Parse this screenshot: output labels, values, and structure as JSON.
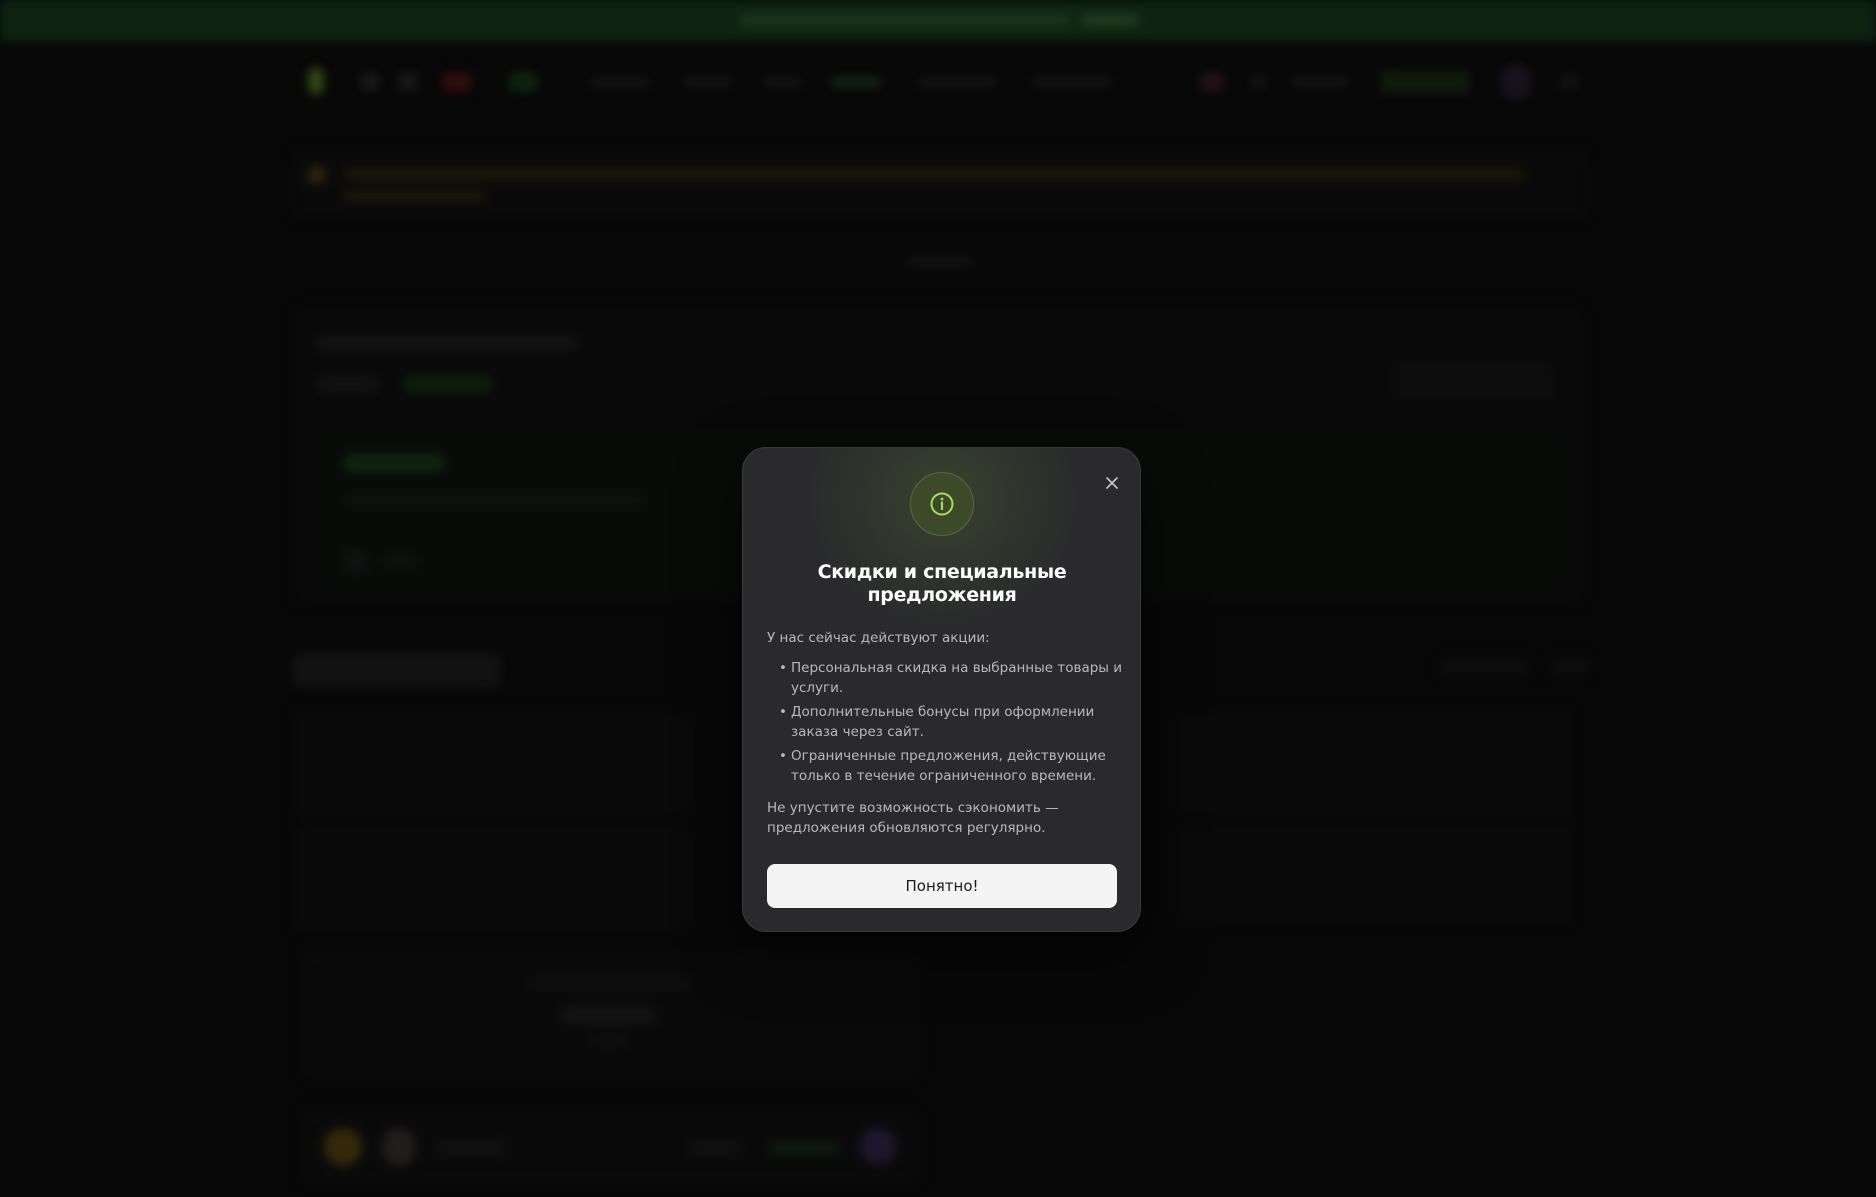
{
  "modal": {
    "title": "Скидки и специальные предложения",
    "intro": "У нас сейчас действуют акции:",
    "items": [
      "Персональная скидка на выбранные товары и услуги.",
      "Дополнительные бонусы при оформлении заказа через сайт.",
      "Ограниченные предложения, действующие только в течение ограниченного времени."
    ],
    "footer": "Не упустите возможность сэкономить — предложения обновляются регулярно.",
    "ok_label": "Понятно!",
    "close_icon": "close-icon",
    "badge_icon": "info-icon"
  },
  "background": {
    "section_title": "Our Servers"
  },
  "colors": {
    "accent_green": "#8fd14f",
    "banner_green": "#1f5b26",
    "modal_bg": "#2a2a2c",
    "button_bg": "#f4f4f5"
  }
}
